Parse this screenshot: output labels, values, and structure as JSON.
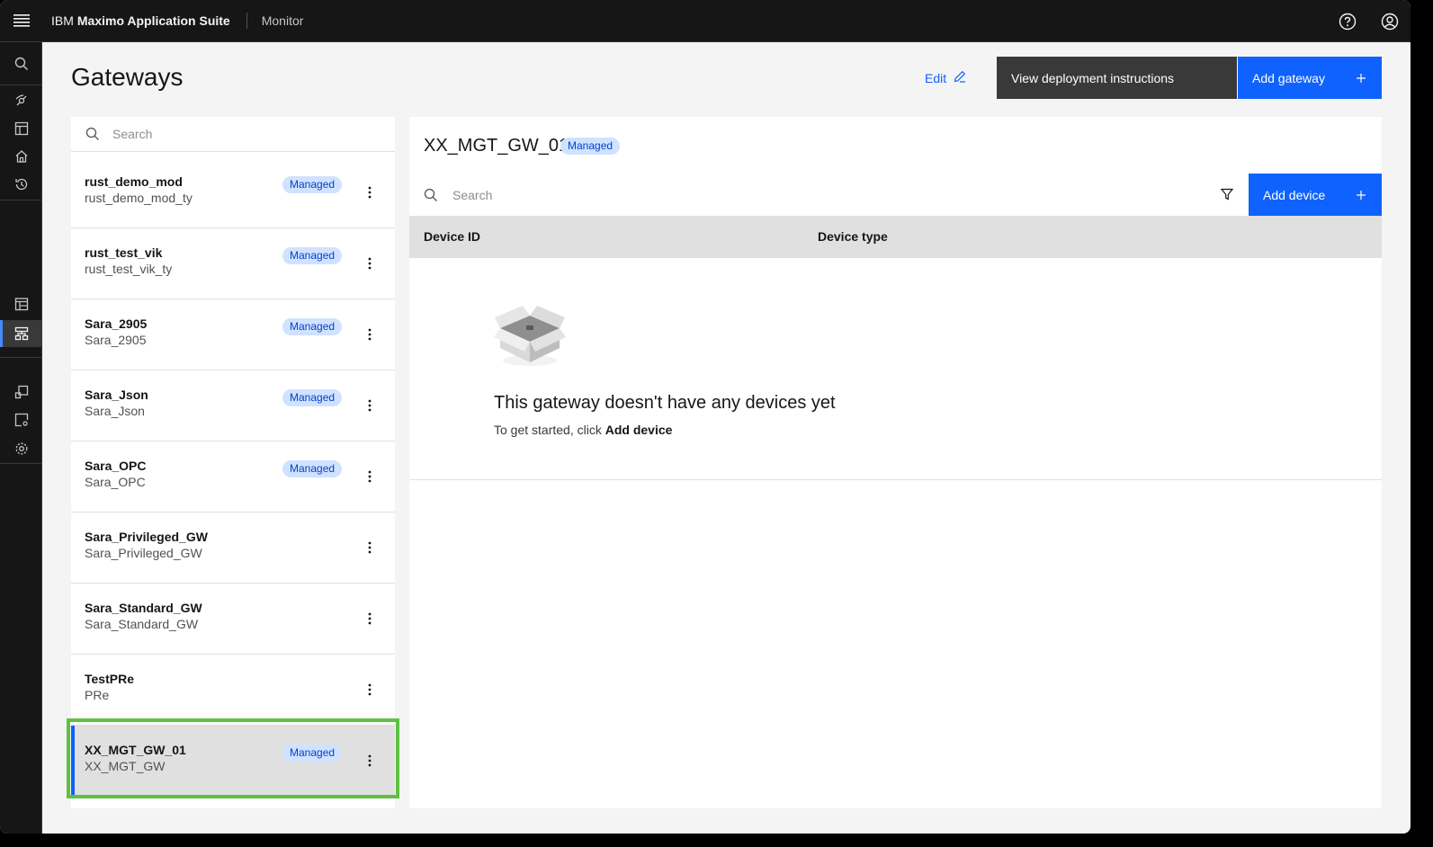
{
  "header": {
    "brand_prefix": "IBM",
    "brand_name": "Maximo Application Suite",
    "module": "Monitor"
  },
  "page": {
    "title": "Gateways",
    "edit_label": "Edit",
    "deploy_label": "View deployment instructions",
    "add_gateway_label": "Add gateway"
  },
  "list": {
    "search_placeholder": "Search",
    "items": [
      {
        "name": "rust_demo_mod",
        "type": "rust_demo_mod_ty",
        "tag": "Managed"
      },
      {
        "name": "rust_test_vik",
        "type": "rust_test_vik_ty",
        "tag": "Managed"
      },
      {
        "name": "Sara_2905",
        "type": "Sara_2905",
        "tag": "Managed"
      },
      {
        "name": "Sara_Json",
        "type": "Sara_Json",
        "tag": "Managed"
      },
      {
        "name": "Sara_OPC",
        "type": "Sara_OPC",
        "tag": "Managed"
      },
      {
        "name": "Sara_Privileged_GW",
        "type": "Sara_Privileged_GW",
        "tag": ""
      },
      {
        "name": "Sara_Standard_GW",
        "type": "Sara_Standard_GW",
        "tag": ""
      },
      {
        "name": "TestPRe",
        "type": "PRe",
        "tag": ""
      },
      {
        "name": "XX_MGT_GW_01",
        "type": "XX_MGT_GW",
        "tag": "Managed"
      }
    ]
  },
  "detail": {
    "title": "XX_MGT_GW_01",
    "tag": "Managed",
    "search_placeholder": "Search",
    "add_device_label": "Add device",
    "columns": [
      "Device ID",
      "Device type"
    ],
    "empty_title": "This gateway doesn't have any devices yet",
    "empty_desc_prefix": "To get started, click",
    "empty_desc_action": "Add device"
  },
  "colors": {
    "primary": "#0f62fe",
    "tag_bg": "#d0e2ff",
    "highlight": "#5ec142",
    "header_bg": "#161616"
  }
}
